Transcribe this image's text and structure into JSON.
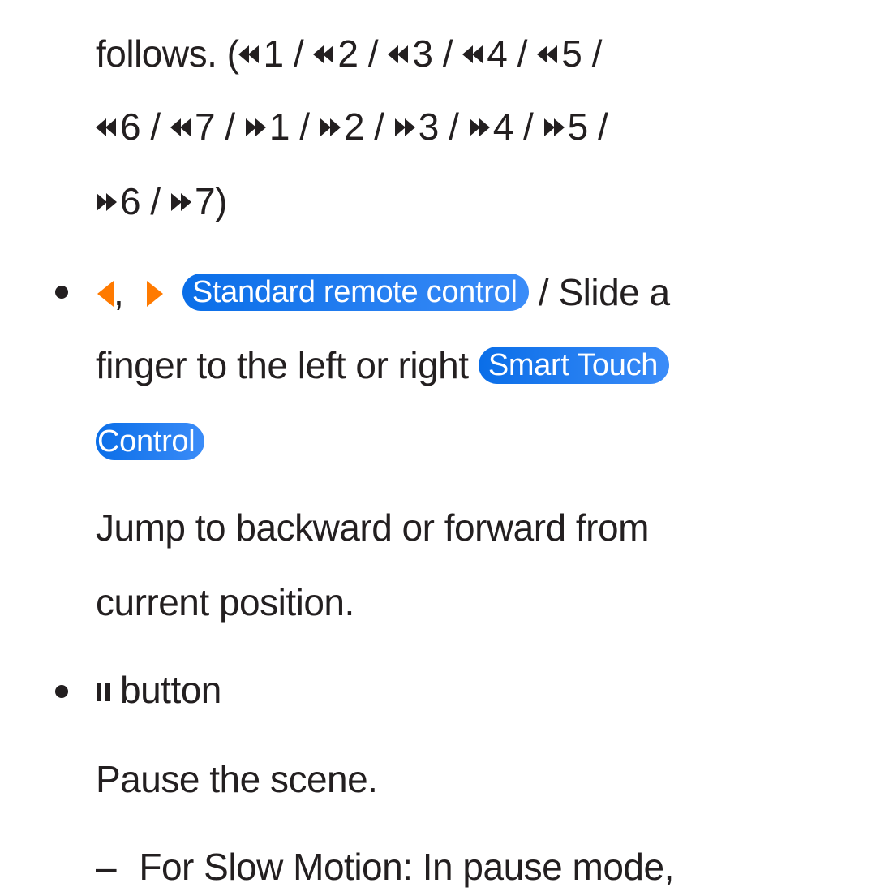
{
  "paragraph_1": {
    "line_1": {
      "prefix": "follows. (",
      "items": [
        {
          "icon": "rewind-icon",
          "text": "1 / "
        },
        {
          "icon": "rewind-icon",
          "text": "2 / "
        },
        {
          "icon": "rewind-icon",
          "text": "3 / "
        },
        {
          "icon": "rewind-icon",
          "text": "4 / "
        },
        {
          "icon": "rewind-icon",
          "text": "5 /"
        }
      ]
    },
    "line_2": {
      "items": [
        {
          "icon": "rewind-icon",
          "text": "6 / "
        },
        {
          "icon": "rewind-icon",
          "text": "7 / "
        },
        {
          "icon": "fast-forward-icon",
          "text": "1 / "
        },
        {
          "icon": "fast-forward-icon",
          "text": "2 / "
        },
        {
          "icon": "fast-forward-icon",
          "text": "3 / "
        },
        {
          "icon": "fast-forward-icon",
          "text": "4 / "
        },
        {
          "icon": "fast-forward-icon",
          "text": "5 /"
        }
      ]
    },
    "line_3": {
      "items": [
        {
          "icon": "fast-forward-icon",
          "text": "6 / "
        },
        {
          "icon": "fast-forward-icon",
          "text": "7)"
        }
      ]
    }
  },
  "bullet_1": {
    "comma": ",",
    "badge_standard_remote": "Standard remote control",
    "text_after_badge": " / Slide a",
    "line_2_text": "finger to the left or right ",
    "badge_smart_touch_part1": "Smart Touch",
    "badge_smart_touch_part2": "Control",
    "description_line_1": "Jump to backward or forward from",
    "description_line_2": "current position."
  },
  "bullet_2": {
    "label": "button",
    "description": "Pause the scene."
  },
  "sub_item": {
    "dash": "–",
    "text": "For Slow Motion: In pause mode,"
  },
  "colors": {
    "text": "#231f20",
    "badge_start": "#0a6ee8",
    "badge_end": "#3b8cf8",
    "arrow_orange": "#ff7a00"
  }
}
